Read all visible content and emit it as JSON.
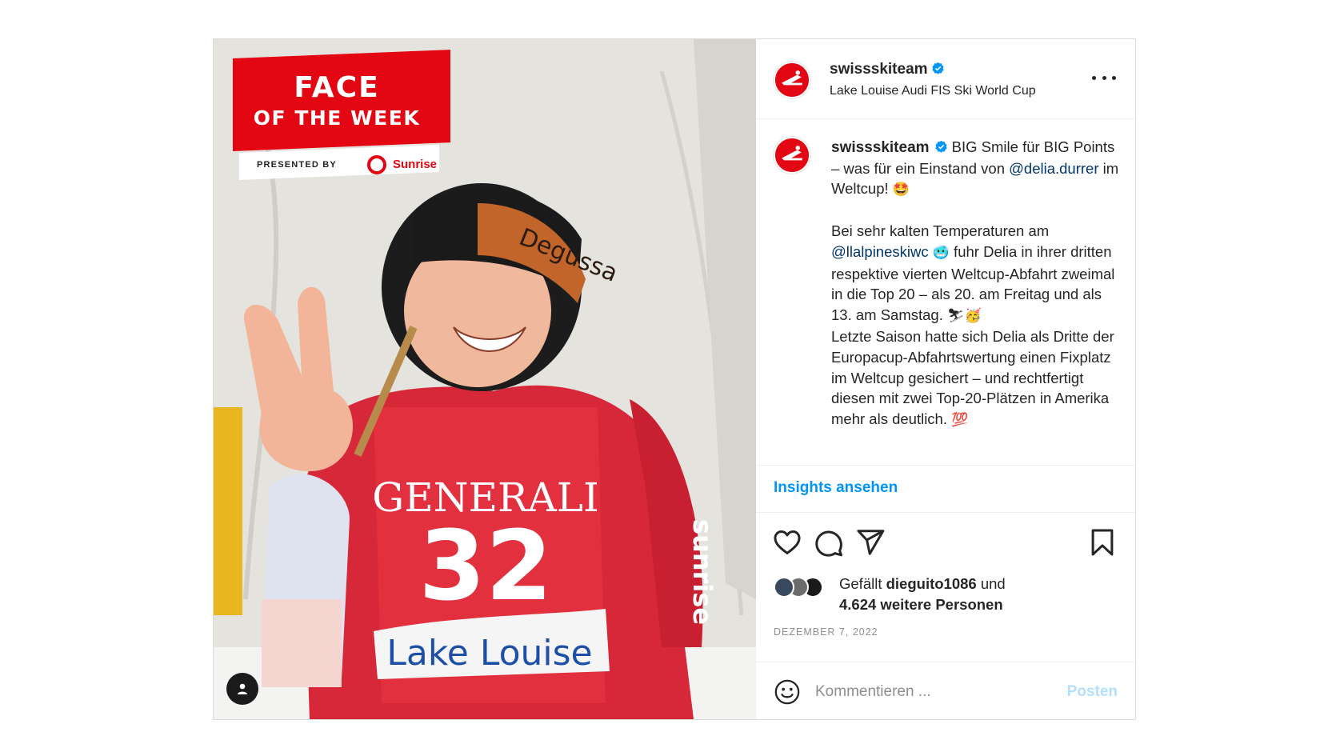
{
  "post": {
    "username": "swissskiteam",
    "location": "Lake Louise Audi FIS Ski World Cup",
    "caption": {
      "username": "swissskiteam",
      "p1_text": " BIG Smile für BIG Points – was für ein Einstand von ",
      "p1_mention": "@delia.durrer",
      "p1_tail": " im Weltcup! ",
      "p1_emoji": "🤩",
      "p2_lead": "Bei sehr kalten Temperaturen am ",
      "p2_mention": "@llalpineskiwc",
      "p2_emoji1": "🥶",
      "p2_text": " fuhr Delia in ihrer dritten respektive vierten Weltcup-Abfahrt zweimal in die Top 20 – als 20. am Freitag und als 13. am Samstag. ",
      "p2_emoji2": "⛷🥳",
      "p3_text": "Letzte Saison hatte sich Delia als Dritte der Europacup-Abfahrtswertung einen Fixplatz im Weltcup gesichert – und rechtfertigt diesen mit zwei Top-20-Plätzen in Amerika mehr als deutlich. ",
      "p3_emoji": "💯"
    },
    "insights_label": "Insights ansehen",
    "likes": {
      "prefix": "Gefällt ",
      "user": "dieguito1086",
      "middle": " und",
      "count": "4.624 weitere Personen"
    },
    "date": "DEZEMBER 7, 2022",
    "comment": {
      "placeholder": "Kommentieren ...",
      "post_label": "Posten"
    }
  },
  "image": {
    "badge_line1": "FACE",
    "badge_line2": "OF THE WEEK",
    "presented_by": "PRESENTED BY",
    "sponsor": "Sunrise",
    "bib_sponsor": "GENERALI",
    "bib_number": "32",
    "bib_venue": "Lake Louise",
    "goggle_brand": "Degussa",
    "sleeve_text": "sunrise"
  },
  "colors": {
    "brand_red": "#e30613",
    "link": "#00376b",
    "insights_blue": "#0095f6",
    "post_disabled": "#b2dffc",
    "verified": "#0095f6"
  },
  "icons": [
    "tag-user-icon",
    "more-options-icon",
    "verified-badge-icon",
    "heart-icon",
    "comment-icon",
    "share-icon",
    "bookmark-icon",
    "emoji-icon",
    "swiss-ski-logo"
  ]
}
